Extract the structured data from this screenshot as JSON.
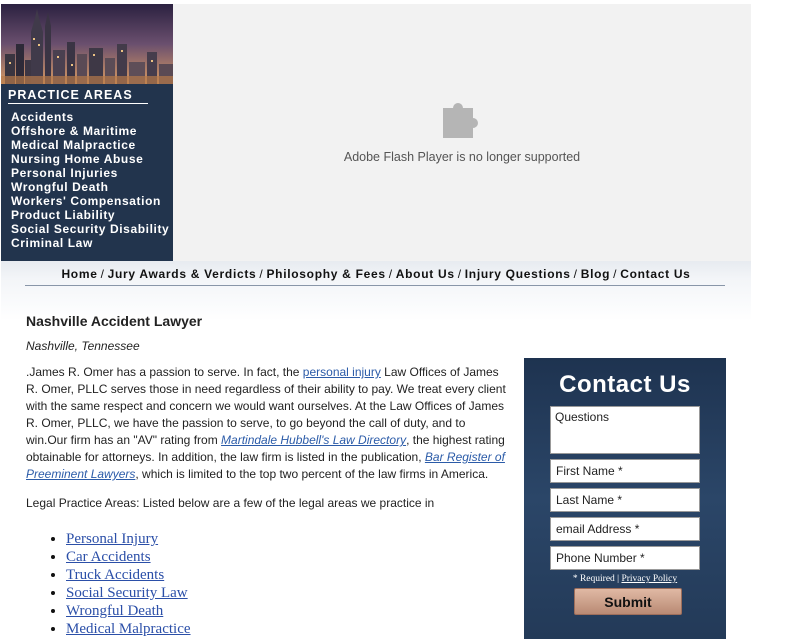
{
  "sidebar": {
    "heading": "PRACTICE AREAS",
    "items": [
      "Accidents",
      "Offshore & Maritime",
      "Medical Malpractice",
      "Nursing Home Abuse",
      "Personal Injuries",
      "Wrongful Death",
      "Workers' Compensation",
      "Product Liability",
      "Social Security Disability",
      "Criminal Law"
    ]
  },
  "flash": {
    "icon": "puzzle-piece-icon",
    "message": "Adobe Flash Player is no longer supported"
  },
  "nav": {
    "separator": "/",
    "items": [
      "Home",
      "Jury Awards & Verdicts",
      "Philosophy & Fees",
      "About Us",
      "Injury Questions",
      "Blog",
      "Contact Us"
    ]
  },
  "main": {
    "title": "Nashville Accident Lawyer",
    "location": "Nashville, Tennessee",
    "intro": {
      "t1": ".James R. Omer has a passion to serve. In fact, the ",
      "link1": "personal injury",
      "t2": " Law Offices of James R. Omer, PLLC serves those in need regardless of their ability to pay. We treat every client with the same respect and concern we would want ourselves. At the Law Offices of James R. Omer, PLLC, we have the passion to serve, to go beyond the call of duty, and to win.Our firm has an \"AV\" rating from ",
      "link2": "Martindale Hubbell's Law Directory",
      "t3": ", the highest rating obtainable for attorneys. In addition, the law firm is listed in the publication, ",
      "link3": "Bar Register of Preeminent Lawyers",
      "t4": ", which is limited to the top two percent of the law firms in America."
    },
    "areas_intro": "Legal Practice Areas: Listed below are a few of the legal areas we practice in",
    "areas": [
      "Personal Injury",
      "Car Accidents",
      "Truck Accidents",
      "Social Security Law",
      "Wrongful Death",
      "Medical Malpractice"
    ]
  },
  "contact": {
    "title": "Contact Us",
    "questions_placeholder": "Questions",
    "first_name_placeholder": "First Name *",
    "last_name_placeholder": "Last Name *",
    "email_placeholder": "email Address *",
    "phone_placeholder": "Phone Number *",
    "required_note": "* Required |",
    "privacy_link": "Privacy Policy",
    "submit_label": "Submit"
  },
  "colors": {
    "sidebar_bg": "#22344d",
    "contact_bg": "#2b4668",
    "link": "#2b5ba8",
    "submit_bg": "#c9a08b"
  }
}
